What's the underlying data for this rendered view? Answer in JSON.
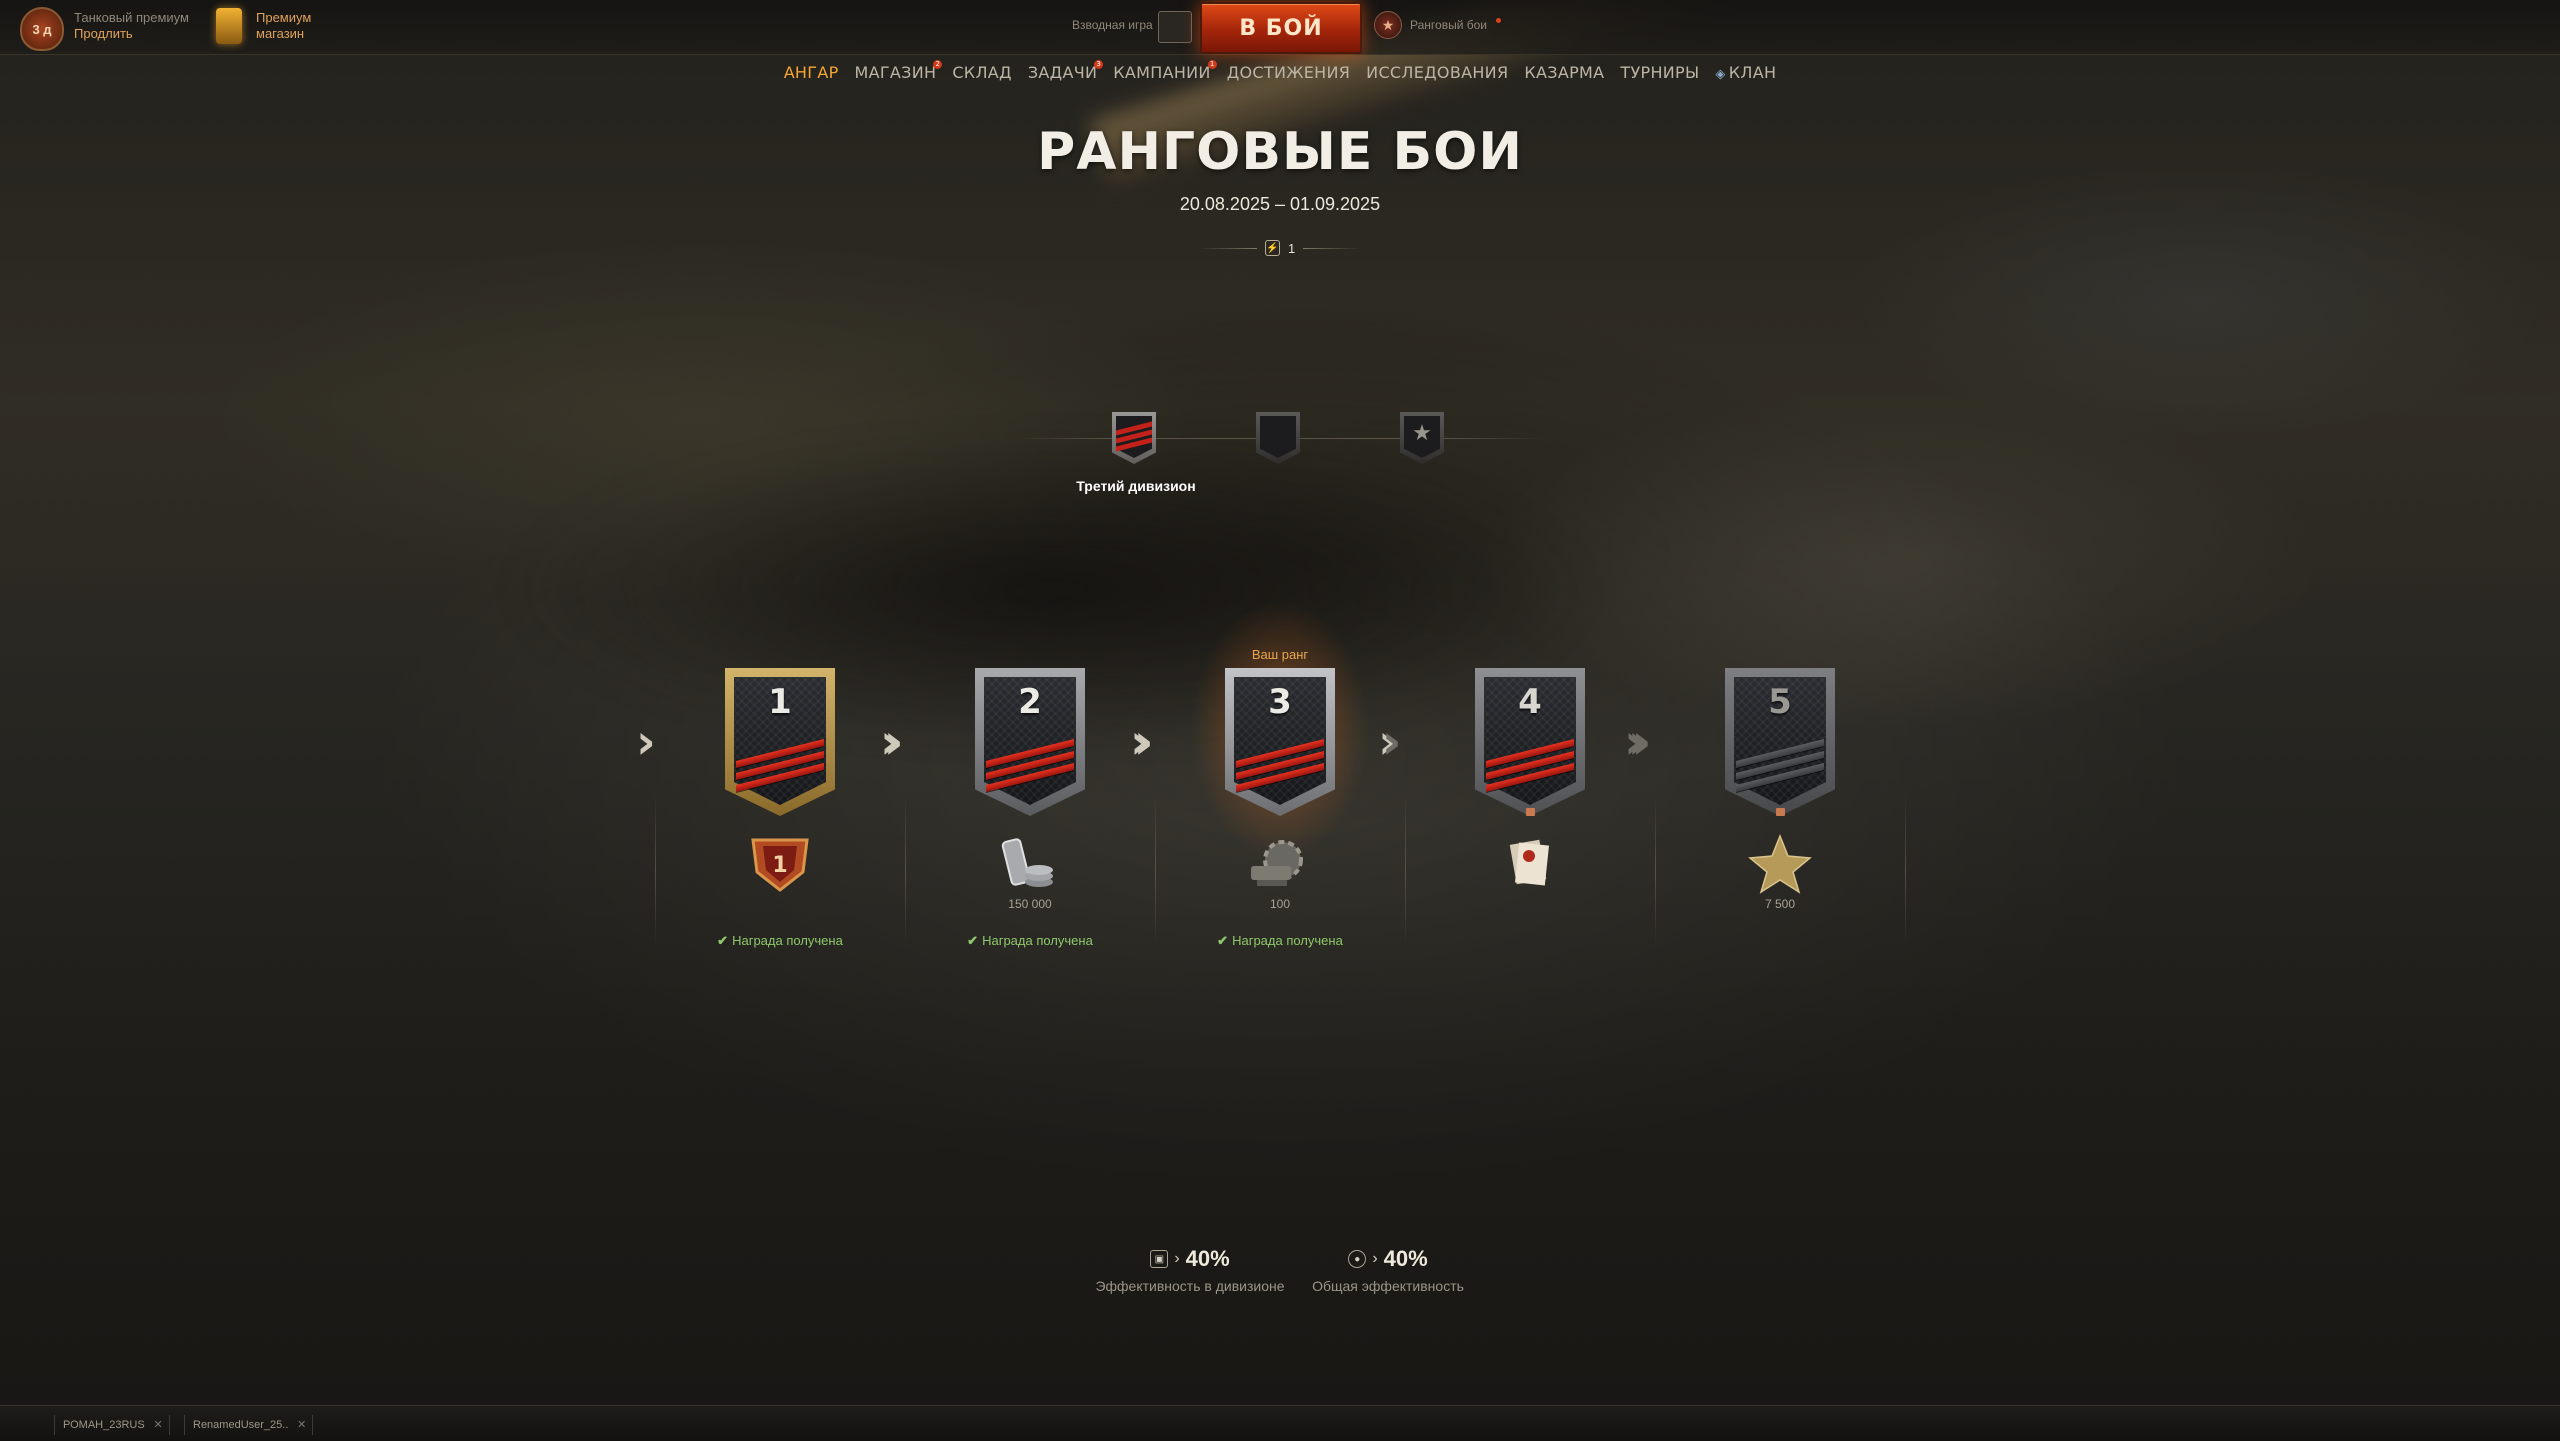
{
  "header": {
    "premium_badge": "3 д",
    "premium_line1": "Танковый премиум",
    "premium_line2": "Продлить",
    "shop_line1": "Премиум",
    "shop_line2": "магазин",
    "platoon_label": "Взводная игра",
    "battle_button": "В БОЙ",
    "mode_label": "Ранговый бои"
  },
  "nav": {
    "items": [
      {
        "label": "АНГАР",
        "active": true,
        "badge": ""
      },
      {
        "label": "МАГАЗИН",
        "active": false,
        "badge": "2"
      },
      {
        "label": "СКЛАД",
        "active": false,
        "badge": ""
      },
      {
        "label": "ЗАДАЧИ",
        "active": false,
        "badge": "3"
      },
      {
        "label": "КАМПАНИИ",
        "active": false,
        "badge": "1"
      },
      {
        "label": "ДОСТИЖЕНИЯ",
        "active": false,
        "badge": ""
      },
      {
        "label": "ИССЛЕДОВАНИЯ",
        "active": false,
        "badge": ""
      },
      {
        "label": "КАЗАРМА",
        "active": false,
        "badge": ""
      },
      {
        "label": "ТУРНИРЫ",
        "active": false,
        "badge": ""
      },
      {
        "label": "КЛАН",
        "active": false,
        "badge": ""
      }
    ]
  },
  "event": {
    "title": "РАНГОВЫЕ БОИ",
    "dates": "20.08.2025 – 01.09.2025",
    "season_number": "1"
  },
  "divisions": {
    "current_label": "Третий дивизион",
    "items": [
      "third",
      "second",
      "first"
    ]
  },
  "ranks": {
    "your_rank_label": "Ваш ранг",
    "items": [
      {
        "number": "1",
        "reward_value": "",
        "status": "Награда получена",
        "reward_icon": "rank-emblem-icon"
      },
      {
        "number": "2",
        "reward_value": "150 000",
        "status": "Награда получена",
        "reward_icon": "credits-icon"
      },
      {
        "number": "3",
        "reward_value": "100",
        "status": "Награда получена",
        "reward_icon": "equipment-icon"
      },
      {
        "number": "4",
        "reward_value": "",
        "status": "",
        "reward_icon": "documents-icon"
      },
      {
        "number": "5",
        "reward_value": "7 500",
        "status": "",
        "reward_icon": "bond-star-icon"
      }
    ]
  },
  "stats": {
    "division_value": "40%",
    "division_label": "Эффективность в дивизионе",
    "overall_value": "40%",
    "overall_label": "Общая эффективность"
  },
  "chat": {
    "tabs": [
      "РОМАН_23RUS",
      "RenamedUser_25.."
    ]
  },
  "colors": {
    "accent": "#f6a531",
    "battle_button": "#c53112",
    "rank_stripe": "#d4281a",
    "reward_received": "#8ec86a"
  }
}
